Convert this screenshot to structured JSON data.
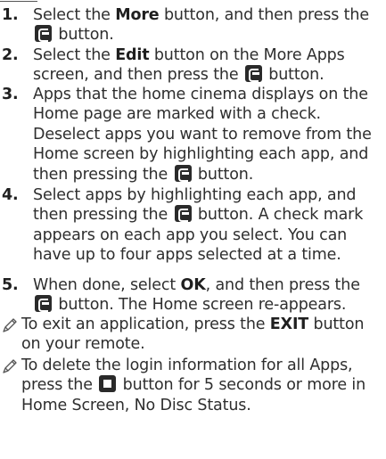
{
  "steps": [
    {
      "num": "1.",
      "p1": "Select the ",
      "b1": "More",
      "p2": " button, and then press the ",
      "p3": " button."
    },
    {
      "num": "2.",
      "p1": "Select the ",
      "b1": "Edit",
      "p2": " button on the More Apps screen, and then press the ",
      "p3": " button."
    },
    {
      "num": "3.",
      "p1": "Apps that the home cinema displays on the Home page are marked with a check. Deselect apps you want to remove from the Home screen by highlighting each app, and then pressing the ",
      "p3": " button."
    },
    {
      "num": "4.",
      "p1": "Select apps by highlighting each app, and then pressing the ",
      "p3": " button. A check mark appears on each app you select. You can have up to four apps selected at a time."
    },
    {
      "num": "5.",
      "p1": "When done, select ",
      "b1": "OK",
      "p2": ", and then press the ",
      "p3": " button. The Home screen re-appears."
    }
  ],
  "notes": [
    {
      "p1": "To exit an application, press the ",
      "b1": "EXIT",
      "p2": " button on your remote."
    },
    {
      "p1": "To delete the login information for all Apps, press the ",
      "p2": " button for 5 seconds or more in Home Screen, No Disc Status."
    }
  ],
  "icons": {
    "enter": "enter-button-icon",
    "stop": "stop-button-icon",
    "note": "pencil-note-icon"
  }
}
